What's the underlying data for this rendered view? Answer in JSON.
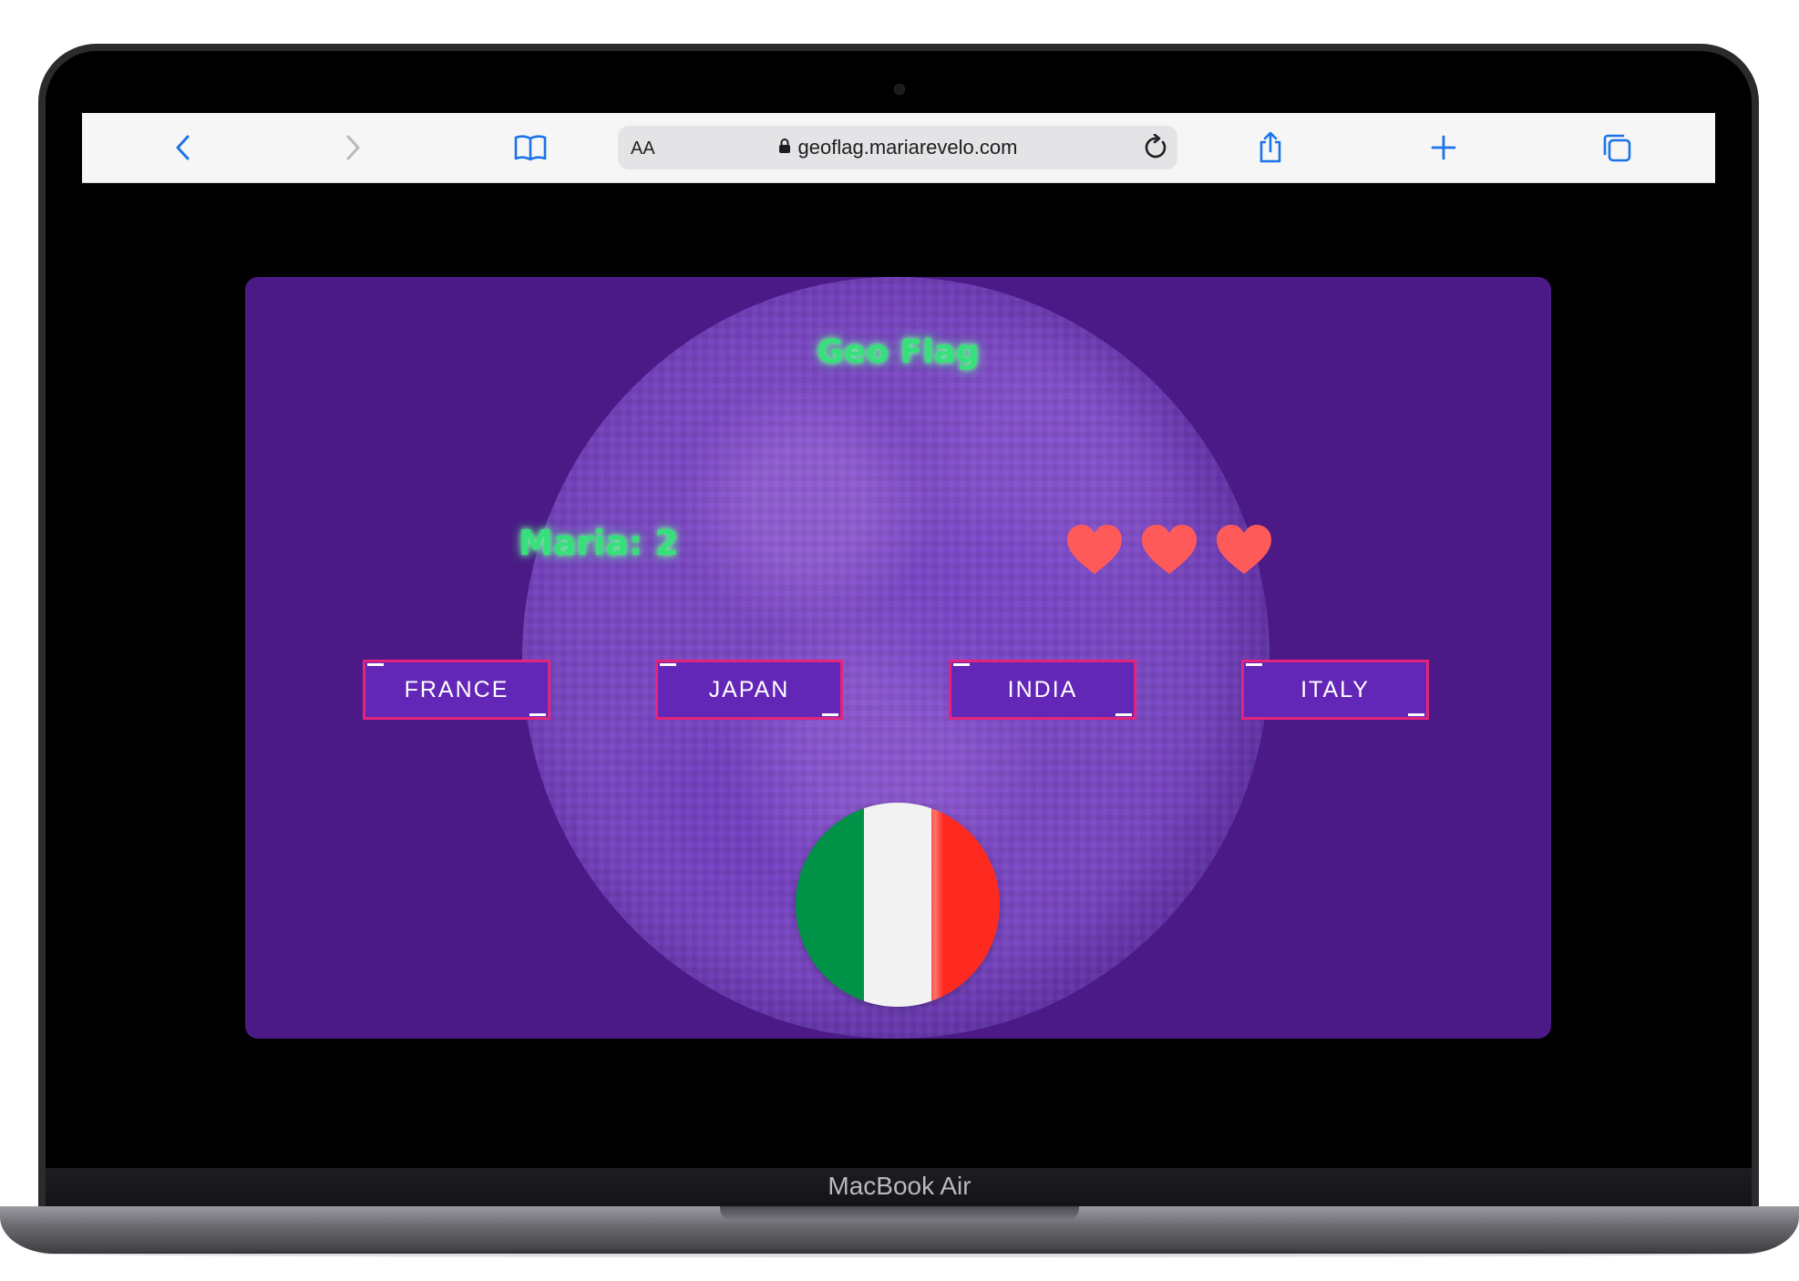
{
  "device": {
    "label": "MacBook Air"
  },
  "browser": {
    "text_size_label": "AA",
    "url": "geoflag.mariarevelo.com",
    "icons": [
      "back-icon",
      "forward-icon",
      "bookmarks-icon",
      "lock-icon",
      "reload-icon",
      "share-icon",
      "new-tab-icon",
      "tabs-icon"
    ]
  },
  "game": {
    "title": "Geo Flag",
    "score_text": "Maria: 2",
    "lives": 3,
    "answers": [
      "FRANCE",
      "JAPAN",
      "INDIA",
      "ITALY"
    ],
    "flag": {
      "country_colors": [
        "#009246",
        "#f1f2f1",
        "#ff2a1f"
      ]
    },
    "colors": {
      "background": "#4b1a86",
      "title_glow": "#36e07a",
      "button_fill": "#6327b7",
      "button_border": "#e2257a",
      "heart": "#ff5a5a"
    }
  }
}
